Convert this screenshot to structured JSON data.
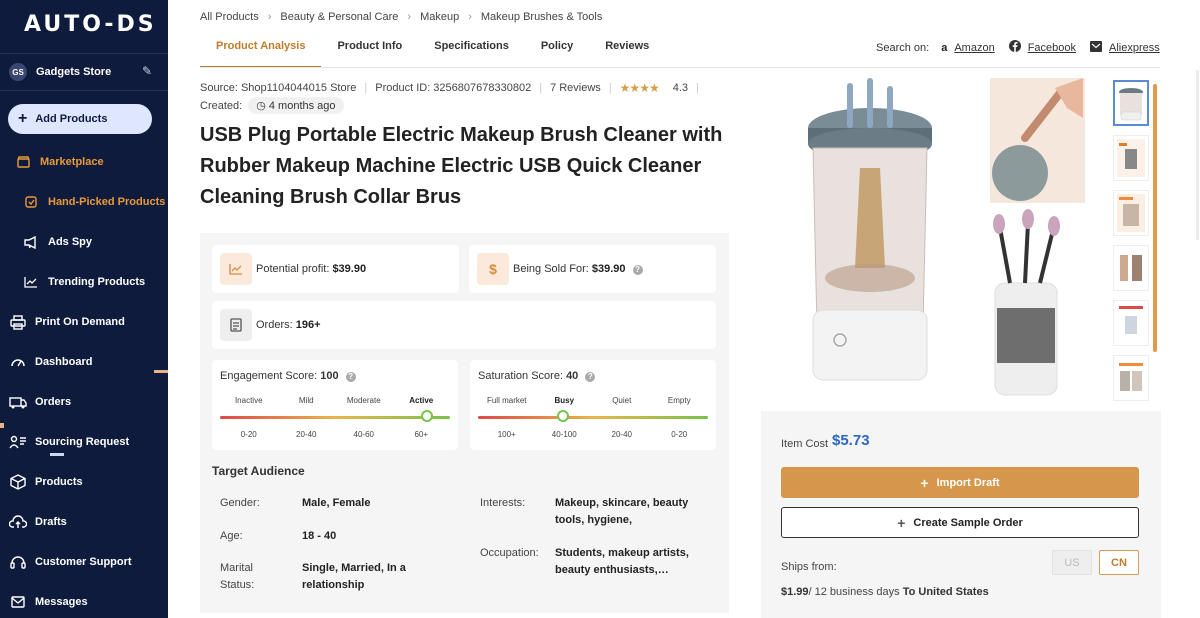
{
  "sidebar": {
    "logo": "AUTO-DS",
    "store": {
      "initials": "GS",
      "name": "Gadgets Store"
    },
    "add_products": "Add Products",
    "items": [
      {
        "label": "Marketplace",
        "icon": "store-icon"
      },
      {
        "label": "Hand-Picked Products",
        "icon": "hand-picked-icon"
      },
      {
        "label": "Ads Spy",
        "icon": "megaphone-icon"
      },
      {
        "label": "Trending Products",
        "icon": "trend-chart-icon"
      },
      {
        "label": "Print On Demand",
        "icon": "print-icon"
      },
      {
        "label": "Dashboard",
        "icon": "gauge-icon"
      },
      {
        "label": "Orders",
        "icon": "orders-icon"
      },
      {
        "label": "Sourcing Request",
        "icon": "sourcing-icon"
      },
      {
        "label": "Products",
        "icon": "box-icon"
      },
      {
        "label": "Drafts",
        "icon": "cloud-upload-icon"
      },
      {
        "label": "Customer Support",
        "icon": "support-icon"
      },
      {
        "label": "Messages",
        "icon": "mail-icon"
      }
    ]
  },
  "breadcrumb": [
    "All Products",
    "Beauty & Personal Care",
    "Makeup",
    "Makeup Brushes & Tools"
  ],
  "tabs": [
    "Product Analysis",
    "Product Info",
    "Specifications",
    "Policy",
    "Reviews"
  ],
  "search_on": {
    "label": "Search on:",
    "links": [
      "Amazon",
      "Facebook",
      "Aliexpress"
    ]
  },
  "meta": {
    "source": "Source: Shop1104044015 Store",
    "product_id": "Product ID: 3256807678330802",
    "reviews": "7 Reviews",
    "stars": "★★★★",
    "rating": "4.3",
    "created_label": "Created:",
    "created_value": "4 months ago"
  },
  "title": "USB Plug Portable Electric Makeup Brush Cleaner with Rubber Makeup Machine Electric USB Quick Cleaner Cleaning Brush Collar Brus",
  "stats": {
    "profit_label": "Potential profit:",
    "profit_value": "$39.90",
    "sold_label": "Being Sold For:",
    "sold_value": "$39.90",
    "orders_label": "Orders:",
    "orders_value": "196+",
    "engagement": {
      "label": "Engagement Score:",
      "value": "100",
      "levels": [
        "Inactive",
        "Mild",
        "Moderate",
        "Active"
      ],
      "ranges": [
        "0-20",
        "20-40",
        "40-60",
        "60+"
      ],
      "active_level": "Active",
      "position": 0.9
    },
    "saturation": {
      "label": "Saturation Score:",
      "value": "40",
      "levels": [
        "Full market",
        "Busy",
        "Quiet",
        "Empty"
      ],
      "ranges": [
        "100+",
        "40-100",
        "20-40",
        "0-20"
      ],
      "active_level": "Busy",
      "position": 0.37
    }
  },
  "target_audience": {
    "title": "Target Audience",
    "gender_label": "Gender:",
    "gender": "Male, Female",
    "age_label": "Age:",
    "age": "18 - 40",
    "marital_label": "Marital Status:",
    "marital": "Single, Married, In a relationship",
    "interests_label": "Interests:",
    "interests": "Makeup, skincare, beauty tools, hygiene, convenience…",
    "occupation_label": "Occupation:",
    "occupation": "Students, makeup artists, beauty enthusiasts,…"
  },
  "purchase": {
    "cost_label": "Item Cost",
    "cost_value": "$5.73",
    "import_label": "Import Draft",
    "sample_label": "Create Sample Order",
    "ships_label": "Ships from:",
    "origins": [
      "US",
      "CN"
    ],
    "selected_origin": "CN",
    "shipping_price": "$1.99",
    "shipping_days": "/ 12 business days",
    "shipping_dest": "To United States"
  },
  "colors": {
    "sidebar_bg": "#0f1b3d",
    "accent": "#c07c2a",
    "import_button": "#d6964c",
    "cost_blue": "#2a66c4"
  }
}
